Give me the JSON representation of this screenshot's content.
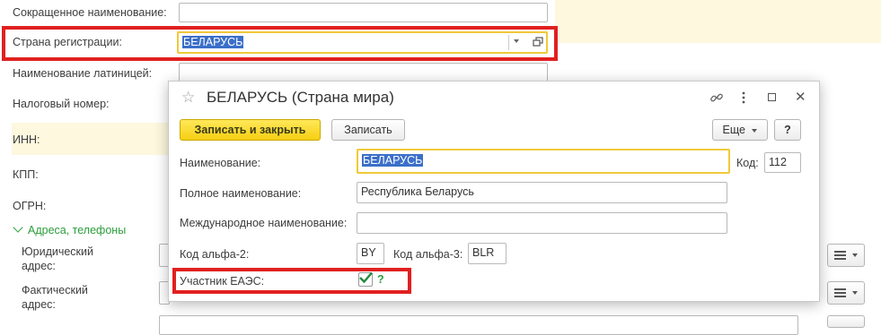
{
  "background_form": {
    "short_name_label": "Сокращенное наименование:",
    "country_label": "Страна регистрации:",
    "country_value": "БЕЛАРУСЬ",
    "latin_name_label": "Наименование латиницей:",
    "tax_number_label": "Налоговый номер:",
    "inn_label": "ИНН:",
    "kpp_label": "КПП:",
    "ogrn_label": "ОГРН:",
    "addresses_section": "Адреса, телефоны",
    "legal_address_label_1": "Юридический",
    "legal_address_label_2": "адрес:",
    "actual_address_label_1": "Фактический",
    "actual_address_label_2": "адрес:"
  },
  "dialog": {
    "title": "БЕЛАРУСЬ (Страна мира)",
    "star_icon": "star-icon",
    "link_icon": "link-icon",
    "more_icon": "kebab-icon",
    "maximize_icon": "maximize-icon",
    "close_icon": "close-icon",
    "toolbar": {
      "save_close_label": "Записать и закрыть",
      "save_label": "Записать",
      "more_label": "Еще",
      "help_label": "?"
    },
    "fields": {
      "name_label": "Наименование:",
      "name_value": "БЕЛАРУСЬ",
      "code_label": "Код:",
      "code_value": "112",
      "full_name_label": "Полное наименование:",
      "full_name_value": "Республика Беларусь",
      "intl_name_label": "Международное наименование:",
      "intl_name_value": "",
      "alpha2_label": "Код альфа-2:",
      "alpha2_value": "BY",
      "alpha3_label": "Код альфа-3:",
      "alpha3_value": "BLR",
      "eaeu_label": "Участник ЕАЭС:",
      "eaeu_help": "?"
    }
  },
  "colors": {
    "highlight_red": "#e02020",
    "primary_button": "#f6cf12",
    "section_green": "#2a9d3a",
    "selection_blue": "#3b6fc9"
  }
}
